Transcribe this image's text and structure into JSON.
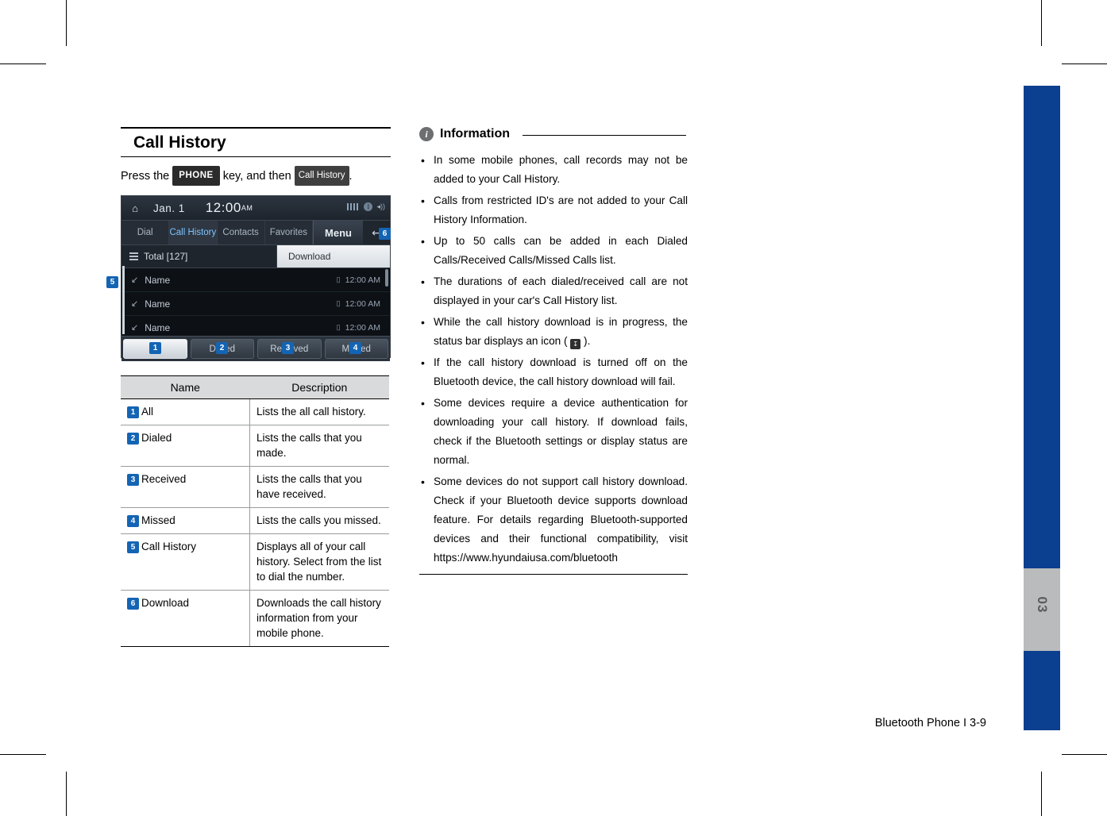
{
  "page": {
    "footer": "Bluetooth Phone I 3-9",
    "side_tab_number": "03"
  },
  "left": {
    "section_title": "Call History",
    "press_text_1": "Press the",
    "key_phone": "PHONE",
    "press_text_2": "key, and then",
    "key_call_history": "Call History",
    "press_text_3": "."
  },
  "head_unit": {
    "home_icon": "home-icon",
    "date": "Jan.  1",
    "clock": "12:00",
    "clock_ampm": "AM",
    "tabs": [
      {
        "label": "Dial",
        "active": false
      },
      {
        "label": "Call History",
        "active": true
      },
      {
        "label": "Contacts",
        "active": false
      },
      {
        "label": "Favorites",
        "active": false
      }
    ],
    "menu_label": "Menu",
    "back_icon": "back-arrow-icon",
    "total_label": "Total [127]",
    "download_label": "Download",
    "rows": [
      {
        "name": "Name",
        "time": "12:00 AM"
      },
      {
        "name": "Name",
        "time": "12:00 AM"
      },
      {
        "name": "Name",
        "time": "12:00 AM"
      }
    ],
    "bottom_buttons": [
      {
        "label": "All",
        "active": true
      },
      {
        "label": "Dialed",
        "active": false
      },
      {
        "label": "Received",
        "active": false
      },
      {
        "label": "Missed",
        "active": false
      }
    ],
    "callouts": {
      "one": "1",
      "two": "2",
      "three": "3",
      "four": "4",
      "five": "5",
      "six": "6"
    }
  },
  "table": {
    "headers": [
      "Name",
      "Description"
    ],
    "rows": [
      {
        "num": "1",
        "name": "All",
        "desc": "Lists the all call history."
      },
      {
        "num": "2",
        "name": "Dialed",
        "desc": "Lists the calls that you made."
      },
      {
        "num": "3",
        "name": "Received",
        "desc": "Lists the calls that you have received."
      },
      {
        "num": "4",
        "name": "Missed",
        "desc": "Lists the calls you missed."
      },
      {
        "num": "5",
        "name": "Call History",
        "desc": "Displays all of your call history. Select from the list to dial the number."
      },
      {
        "num": "6",
        "name": "Download",
        "desc": "Downloads the call history information from your mobile phone."
      }
    ]
  },
  "information": {
    "title": "Information",
    "items": [
      "In some mobile phones, call records may not be added to your Call History.",
      "Calls from restricted ID's are not added to your Call History Information.",
      "Up to 50 calls can be added in each Dialed Calls/Received Calls/Missed Calls list.",
      "The durations of each dialed/received call are not displayed in your car's Call History list.",
      "While the call history download is in progress, the status bar displays an icon (  ).",
      "If the call history download is turned off on the Bluetooth device, the call history download will fail.",
      "Some devices require a device authentication for downloading your call history. If download fails, check if the Bluetooth settings or display status are normal.",
      "Some devices do not support call history download. Check if your Bluetooth device supports download feature. For details regarding Bluetooth-supported devices and their functional compatibility, visit https://www.hyundaiusa.com/bluetooth"
    ],
    "download_icon_label": "download-status-icon"
  },
  "colors": {
    "badge": "#1464b4",
    "side_tab": "#0b3f8f",
    "side_tab_grey": "#b9bbbd",
    "table_header": "#d9dadc"
  }
}
